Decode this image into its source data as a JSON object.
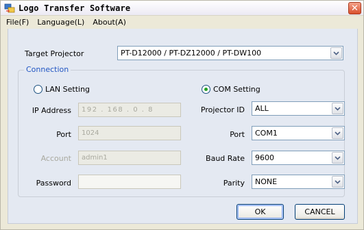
{
  "window": {
    "title": "Logo Transfer Software",
    "close_glyph": "✕"
  },
  "menu": [
    {
      "label": "File(F)"
    },
    {
      "label": "Language(L)"
    },
    {
      "label": "About(A)"
    }
  ],
  "target_projector": {
    "label": "Target Projector",
    "value": "PT-D12000 / PT-DZ12000 / PT-DW100"
  },
  "connection": {
    "group_label": "Connection",
    "lan": {
      "radio_label": "LAN Setting",
      "selected": false,
      "ip_label": "IP Address",
      "ip_value": "192 . 168 . 0 . 8",
      "port_label": "Port",
      "port_value": "1024",
      "account_label": "Account",
      "account_value": "admin1",
      "password_label": "Password",
      "password_value": ""
    },
    "com": {
      "radio_label": "COM Setting",
      "selected": true,
      "projector_id_label": "Projector ID",
      "projector_id_value": "ALL",
      "port_label": "Port",
      "port_value": "COM1",
      "baud_label": "Baud Rate",
      "baud_value": "9600",
      "parity_label": "Parity",
      "parity_value": "NONE"
    }
  },
  "buttons": {
    "ok": "OK",
    "cancel": "CANCEL"
  },
  "icons": {
    "app": "logo-transfer-app-icon",
    "dropdown": "chevron-down-icon",
    "close": "close-icon"
  },
  "colors": {
    "group_title": "#2256c3",
    "radio_dot": "#21a121",
    "close_button": "#d94f2b"
  }
}
